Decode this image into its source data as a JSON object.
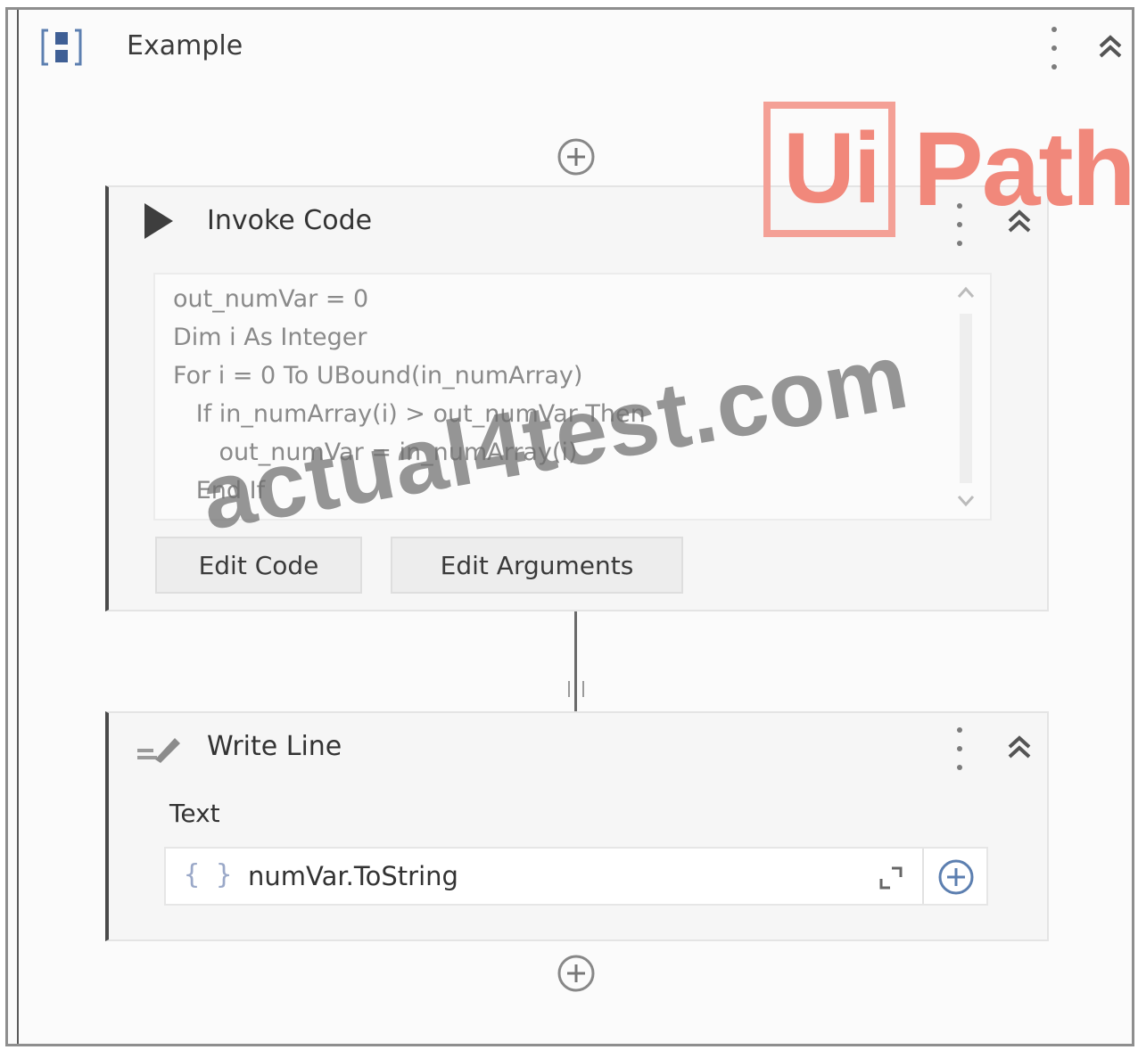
{
  "sequence": {
    "title": "Example"
  },
  "invoke_code": {
    "title": "Invoke Code",
    "code_lines": [
      "out_numVar = 0",
      "Dim i As Integer",
      "For i = 0 To UBound(in_numArray)",
      "   If in_numArray(i) > out_numVar Then",
      "      out_numVar = in_numArray(i)",
      "   End If"
    ],
    "edit_code_label": "Edit Code",
    "edit_arguments_label": "Edit Arguments"
  },
  "write_line": {
    "title": "Write Line",
    "text_label": "Text",
    "text_braces": "{ }",
    "text_value": "numVar.ToString"
  },
  "logo": {
    "box_text": "Ui",
    "text": "Path",
    "color": "#f1887b"
  },
  "watermark": "actual4test.com",
  "colors": {
    "accent_border": "#4a4a4a",
    "logo": "#f1887b"
  }
}
